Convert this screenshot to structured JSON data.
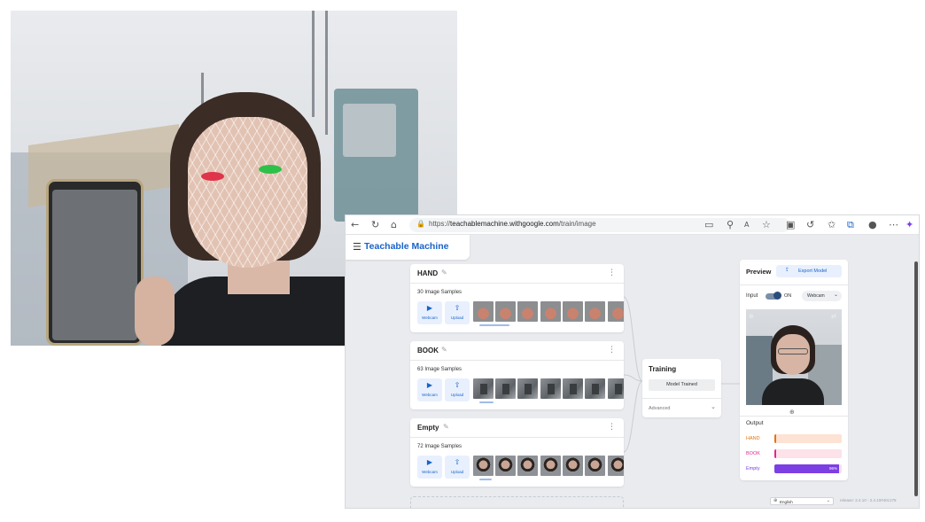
{
  "browser": {
    "url_scheme": "https://",
    "url_host": "teachablemachine.withgoogle.com",
    "url_path": "/train/image"
  },
  "app": {
    "title": "Teachable Machine"
  },
  "classes": [
    {
      "name": "HAND",
      "samples": "30 Image Samples",
      "webcam_label": "Webcam",
      "upload_label": "Upload"
    },
    {
      "name": "BOOK",
      "samples": "63 Image Samples",
      "webcam_label": "Webcam",
      "upload_label": "Upload"
    },
    {
      "name": "Empty",
      "samples": "72 Image Samples",
      "webcam_label": "Webcam",
      "upload_label": "Upload"
    }
  ],
  "training": {
    "title": "Training",
    "status_button": "Model Trained",
    "advanced_label": "Advanced"
  },
  "preview": {
    "title": "Preview",
    "export_label": "Export Model",
    "input_label": "Input",
    "toggle_state": "ON",
    "camera_select": "Webcam",
    "output_label": "Output",
    "outputs": [
      {
        "label": "HAND",
        "value": 0.02,
        "display": "",
        "color": "#e8710a",
        "track": "#fde3d4"
      },
      {
        "label": "BOOK",
        "value": 0.02,
        "display": "",
        "color": "#e52592",
        "track": "#fde2ea"
      },
      {
        "label": "Empty",
        "value": 0.96,
        "display": "96%",
        "color": "#7b3fe4",
        "track": "#ece3fb"
      }
    ]
  },
  "footer": {
    "language": "English",
    "release": "release: 2.4.10 - 2.4.10#40c178"
  },
  "colors": {
    "brand": "#1a63c8",
    "accent_blue": "#e8f0fe"
  },
  "icons": [
    "back-icon",
    "reload-icon",
    "home-icon",
    "lock-icon",
    "menu-icon",
    "pencil-icon",
    "more-vert-icon",
    "webcam-icon",
    "upload-icon",
    "export-icon",
    "chevron-down-icon",
    "globe-icon"
  ]
}
